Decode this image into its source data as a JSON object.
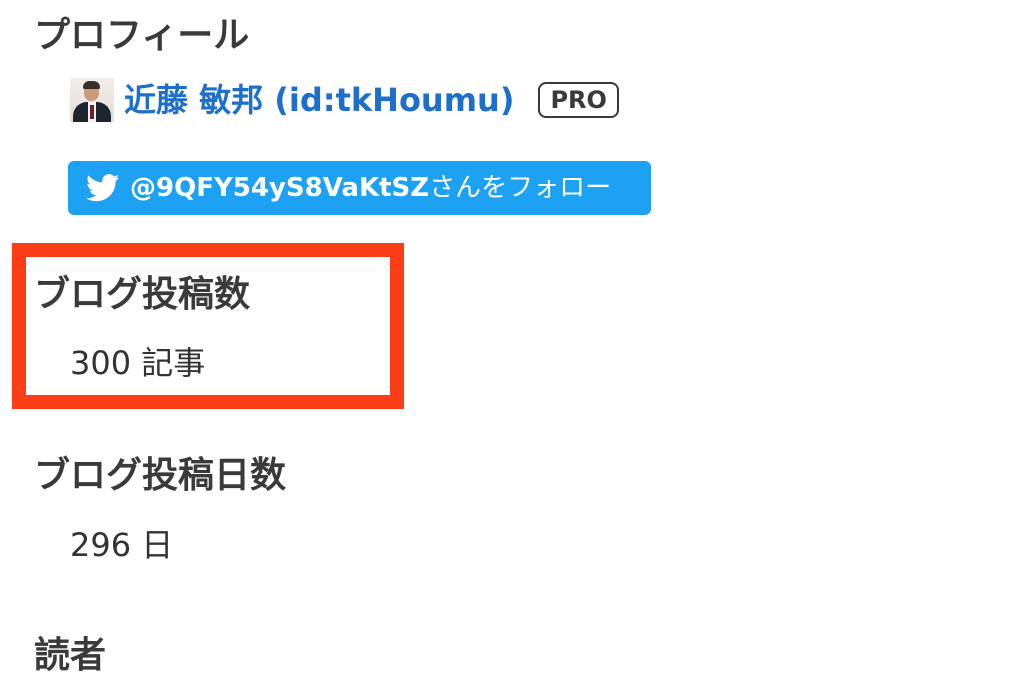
{
  "profile": {
    "title": "プロフィール",
    "display_name": "近藤 敏邦 (id:tkHoumu)",
    "badge": "PRO",
    "twitter_handle": "@9QFY54yS8VaKtSZ",
    "twitter_suffix": "さんをフォロー"
  },
  "blog_posts": {
    "title": "ブログ投稿数",
    "value": "300 記事"
  },
  "blog_days": {
    "title": "ブログ投稿日数",
    "value": "296 日"
  },
  "readers": {
    "title": "読者"
  },
  "colors": {
    "link": "#1d6fc9",
    "twitter_blue": "#1da1f2",
    "highlight": "#fb3e17"
  },
  "icons": {
    "avatar": "avatar",
    "twitter": "twitter-bird-icon"
  }
}
